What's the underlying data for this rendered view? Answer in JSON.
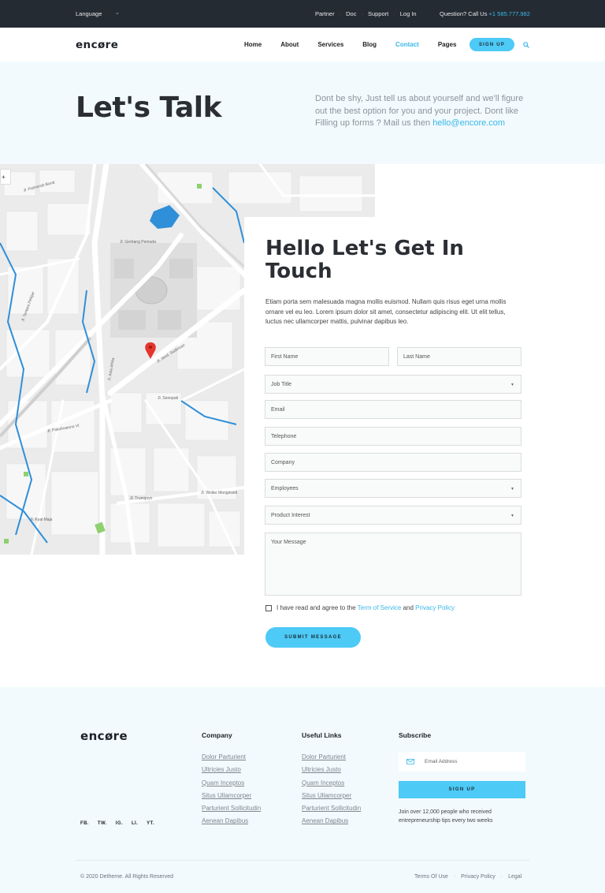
{
  "topbar": {
    "language": "Language",
    "links": [
      "Partner",
      "Doc",
      "Support",
      "Log In"
    ],
    "question": "Question? Call Us",
    "phone": "+1 585.777.982"
  },
  "nav": {
    "logo": "encøre",
    "items": [
      "Home",
      "About",
      "Services",
      "Blog",
      "Contact",
      "Pages"
    ],
    "active": "Contact",
    "signup": "SIGN UP"
  },
  "hero": {
    "title": "Let's Talk",
    "description": "Dont be shy, Just tell us about yourself and we'll figure out the best option for you and your project. Dont like Filling up forms ? Mail us then",
    "email": "hello@encore.com"
  },
  "map": {
    "labels": [
      "Jl. Gerbang Pemuda",
      "Jl. Jend. Sudirman",
      "Jl. Asia Afrika",
      "Jl. Trunojoyo",
      "Jl. Wolter Monginsidi",
      "Jl. Senopati",
      "Jl. Palmerah Barat",
      "Jl. Tentara Pelajar",
      "Jl. Pakubuwono VI",
      "Jl. Kyai Maja"
    ]
  },
  "form": {
    "heading_hl": "Hello",
    "heading_rest": " Let's Get In Touch",
    "intro": "Etiam porta sem malesuada magna mollis euismod. Nullam quis risus eget urna mollis ornare vel eu leo. Lorem ipsum dolor sit amet, consectetur adipiscing elit. Ut elit tellus, luctus nec ullamcorper mattis, pulvinar dapibus leo.",
    "first_name": "First Name",
    "last_name": "Last Name",
    "job_title": "Job Title",
    "email": "Email",
    "telephone": "Telephone",
    "company": "Company",
    "employees": "Employees",
    "product_interest": "Product Interest",
    "message": "Your Message",
    "agree_prefix": "I have read and agree to the",
    "terms": "Term of Service",
    "and": "and",
    "privacy": "Privacy Policy",
    "submit": "SUBMIT MESSAGE"
  },
  "footer": {
    "logo": "encøre",
    "social": [
      "FB.",
      "TW.",
      "IG.",
      "LI.",
      "YT."
    ],
    "company_title": "Company",
    "company_links": [
      "Dolor Parturient",
      "Ultricies Justo",
      "Quam Inceptos",
      "Situs Ullamcorper",
      "Parturient Sollicitudin",
      "Aenean Dapibus"
    ],
    "useful_title": "Useful Links",
    "useful_links": [
      "Dolor Parturient",
      "Ultricies Justo",
      "Quam Inceptos",
      "Situs Ullamcorper",
      "Parturient Sollicitudin",
      "Aenean Dapibus"
    ],
    "subscribe_title": "Subscribe",
    "email_placeholder": "Email Address",
    "signup": "SIGN UP",
    "note": "Join over 12,000 people who received entrepreneurship tips every two weeks",
    "copyright": "© 2020 Detheme. All Rights Reserved",
    "legal": [
      "Terms Of Use",
      "Privacy Policy",
      "Legal"
    ]
  },
  "colors": {
    "accent": "#4dcaf6",
    "link": "#39b7e8",
    "dark": "#252b33",
    "pale": "#f2fafd"
  }
}
